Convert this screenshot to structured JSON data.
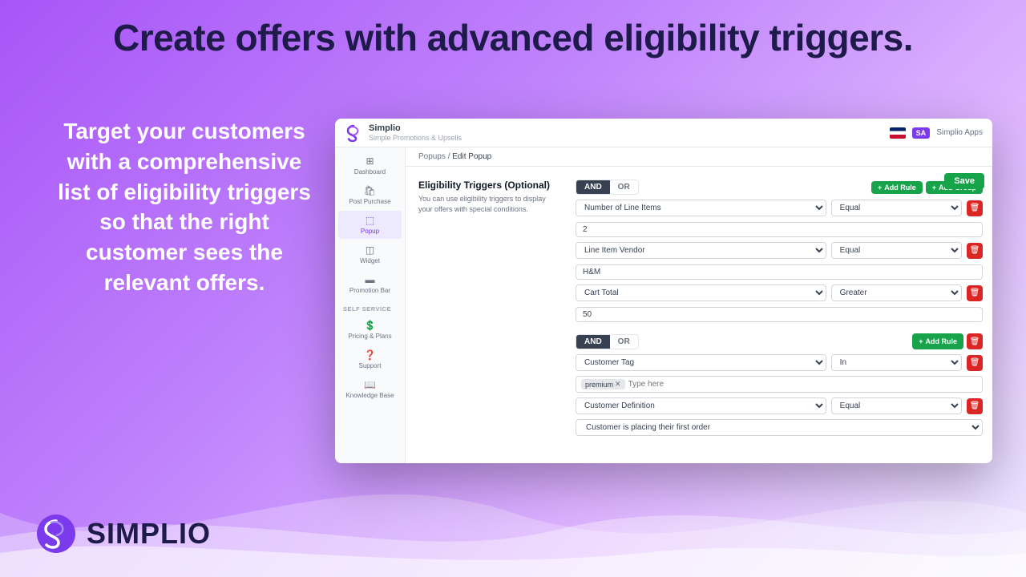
{
  "page": {
    "background_color": "#b07ef5"
  },
  "headline": "Create offers with advanced eligibility triggers.",
  "left_text": "Target your customers with a comprehensive list of eligibility triggers so that the right customer sees the relevant offers.",
  "app": {
    "title": "Simplio",
    "subtitle": "Simple Promotions & Upsells",
    "breadcrumb_base": "Popups",
    "breadcrumb_current": "Edit Popup",
    "save_button": "Save",
    "sa_badge": "SA",
    "simplio_apps_label": "Simplio Apps"
  },
  "sidebar": {
    "items": [
      {
        "label": "Dashboard",
        "icon": "⊞",
        "active": false
      },
      {
        "label": "Post Purchase",
        "icon": "🛍",
        "active": false
      },
      {
        "label": "Popup",
        "icon": "⬚",
        "active": true
      },
      {
        "label": "Widget",
        "icon": "◫",
        "active": false
      },
      {
        "label": "Promotion Bar",
        "icon": "▬",
        "active": false
      }
    ],
    "self_service_label": "SELF SERVICE",
    "self_service_items": [
      {
        "label": "Pricing & Plans",
        "icon": "💲",
        "active": false
      },
      {
        "label": "Support",
        "icon": "❓",
        "active": false
      },
      {
        "label": "Knowledge Base",
        "icon": "📖",
        "active": false
      }
    ]
  },
  "eligibility": {
    "title": "Eligibility Triggers (Optional)",
    "description": "You can use eligibility triggers to display your offers with special conditions.",
    "groups": [
      {
        "and_active": true,
        "or_active": false,
        "and_label": "AND",
        "or_label": "OR",
        "add_rule_label": "+ Add Rule",
        "add_group_label": "+ Add Group",
        "rules": [
          {
            "field": "Number of Line Items",
            "operator": "Equal",
            "value": "2"
          },
          {
            "field": "Line Item Vendor",
            "operator": "Equal",
            "value": "H&M"
          },
          {
            "field": "Cart Total",
            "operator": "Greater",
            "value": "50"
          }
        ]
      },
      {
        "and_active": true,
        "or_active": false,
        "and_label": "AND",
        "or_label": "OR",
        "add_rule_label": "+ Add Rule",
        "rules": [
          {
            "field": "Customer Tag",
            "operator": "In",
            "tag": "premium",
            "tag_placeholder": "Type here"
          },
          {
            "field": "Customer Definition",
            "operator": "Equal",
            "dropdown": "Customer is placing their first order"
          }
        ]
      }
    ]
  },
  "logo": {
    "text": "SIMPLIO"
  }
}
